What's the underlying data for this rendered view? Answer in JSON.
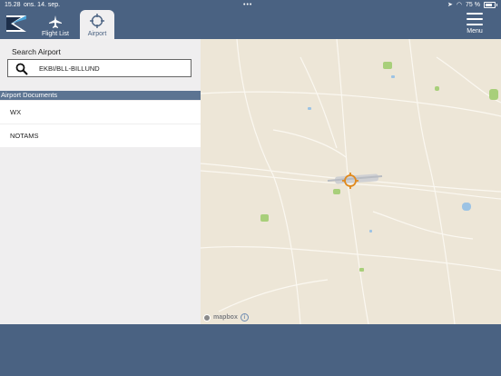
{
  "status": {
    "time": "15.28",
    "date": "ons. 14. sep.",
    "battery": "75 %"
  },
  "nav": {
    "flight_list": "Flight List",
    "airport": "Airport",
    "menu": "Menu"
  },
  "search": {
    "label": "Search Airport",
    "value": "EKBI/BLL-BILLUND"
  },
  "documents": {
    "header": "Airport Documents",
    "items": [
      "WX",
      "NOTAMS"
    ]
  },
  "map": {
    "attribution": "mapbox",
    "info": "i",
    "marker_color": "#e08a1e"
  },
  "colors": {
    "brand": "#4a6282",
    "section_header": "#5c7492"
  }
}
